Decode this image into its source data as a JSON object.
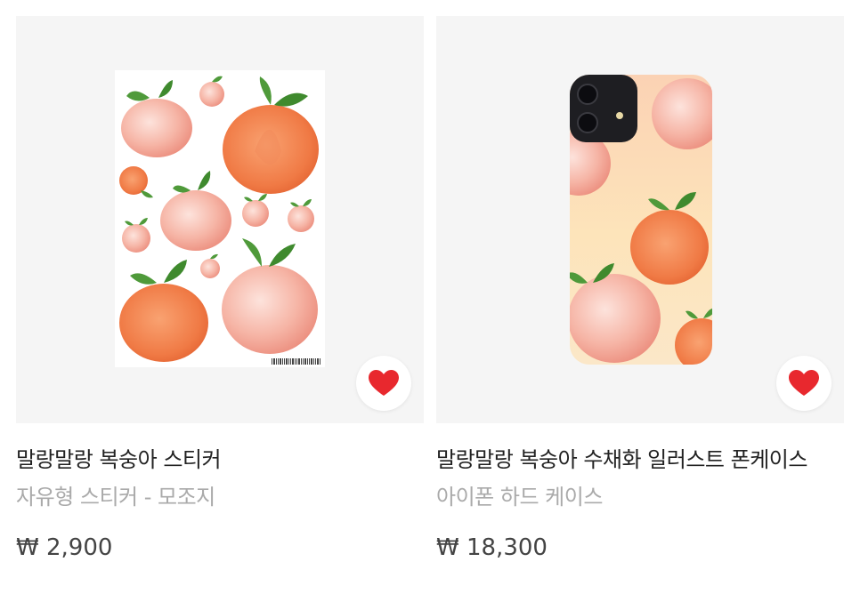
{
  "products": [
    {
      "title": "말랑말랑 복숭아 스티커",
      "option": "자유형 스티커 - 모조지",
      "price": "₩ 2,900",
      "favorite_icon": "heart-icon",
      "accent_color": "#e8282e"
    },
    {
      "title": "말랑말랑 복숭아 수채화 일러스트 폰케이스",
      "option": "아이폰 하드 케이스",
      "price": "₩ 18,300",
      "favorite_icon": "heart-icon",
      "accent_color": "#e8282e"
    }
  ]
}
